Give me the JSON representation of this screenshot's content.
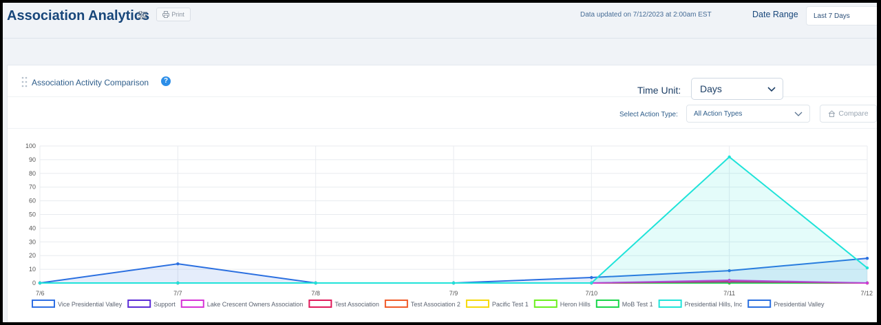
{
  "header": {
    "title": "Association Analytics",
    "print_label": "Print",
    "data_updated": "Data updated on 7/12/2023 at 2:00am EST",
    "date_range_label": "Date Range",
    "date_range_value": "Last 7 Days"
  },
  "card": {
    "title": "Association Activity Comparison",
    "help": "?",
    "time_unit_label": "Time Unit:",
    "time_unit_value": "Days",
    "action_type_label": "Select Action Type:",
    "action_type_value": "All Action Types",
    "compare_label": "Compare"
  },
  "icons": {
    "filter": "sliders-icon",
    "print": "printer-icon",
    "drag": "drag-handle-icon",
    "help": "help-circle-icon",
    "chevron": "chevron-down-icon",
    "compare": "home-icon"
  },
  "colors": {
    "title": "#17467a",
    "accent": "#2c8ee8"
  },
  "chart_data": {
    "type": "area",
    "categories": [
      "7/6",
      "7/7",
      "7/8",
      "7/9",
      "7/10",
      "7/11",
      "7/12"
    ],
    "ylim": [
      0,
      100
    ],
    "yticks": [
      0,
      10,
      20,
      30,
      40,
      50,
      60,
      70,
      80,
      90,
      100
    ],
    "grid": true,
    "legend_position": "bottom",
    "series": [
      {
        "name": "Vice Presidential Valley",
        "color": "#2f6fe4",
        "values": [
          0,
          0,
          0,
          0,
          0,
          0,
          0
        ]
      },
      {
        "name": "Support",
        "color": "#5b2bd6",
        "values": [
          0,
          0,
          0,
          0,
          0,
          0,
          0
        ]
      },
      {
        "name": "Lake Crescent Owners Association",
        "color": "#d633d6",
        "values": [
          0,
          0,
          0,
          0,
          0,
          2,
          0
        ]
      },
      {
        "name": "Test Association",
        "color": "#e0195a",
        "values": [
          0,
          0,
          0,
          0,
          0,
          1,
          0
        ]
      },
      {
        "name": "Test Association 2",
        "color": "#f05a28",
        "values": [
          0,
          0,
          0,
          0,
          0,
          0,
          0
        ]
      },
      {
        "name": "Pacific Test 1",
        "color": "#f5d90a",
        "values": [
          0,
          0,
          0,
          0,
          0,
          0,
          0
        ]
      },
      {
        "name": "Heron Hills",
        "color": "#6cf01e",
        "values": [
          0,
          0,
          0,
          0,
          0,
          0,
          0
        ]
      },
      {
        "name": "MoB Test 1",
        "color": "#19d64a",
        "values": [
          0,
          0,
          0,
          0,
          0,
          0,
          0
        ]
      },
      {
        "name": "Presidential Hills, Inc",
        "color": "#1fe3d9",
        "values": [
          0,
          0,
          0,
          0,
          0,
          92,
          11
        ]
      },
      {
        "name": "Presidential Valley",
        "color": "#2a6fe0",
        "values": [
          0,
          14,
          0,
          0,
          4,
          9,
          18
        ]
      }
    ]
  }
}
